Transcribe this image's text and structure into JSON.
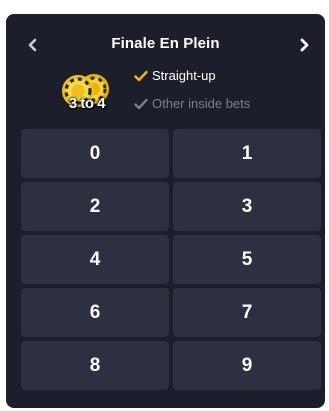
{
  "header": {
    "title": "Finale En Plein",
    "prev_icon": "chevron-left-icon",
    "next_icon": "chevron-right-icon"
  },
  "badge": {
    "label": "3 to 4",
    "icon": "roulette-chips-icon",
    "color": "#f5c518"
  },
  "bet_types": [
    {
      "label": "Straight-up",
      "checked": true,
      "check_color": "#f5b71f"
    },
    {
      "label": "Other inside bets",
      "checked": true,
      "check_color": "#7b7f8c"
    }
  ],
  "numbers": [
    "0",
    "1",
    "2",
    "3",
    "4",
    "5",
    "6",
    "7",
    "8",
    "9"
  ],
  "colors": {
    "panel_bg": "#1c1f2b",
    "cell_bg": "#2c3040",
    "accent": "#f5b71f",
    "muted_text": "#7b7f8c"
  }
}
